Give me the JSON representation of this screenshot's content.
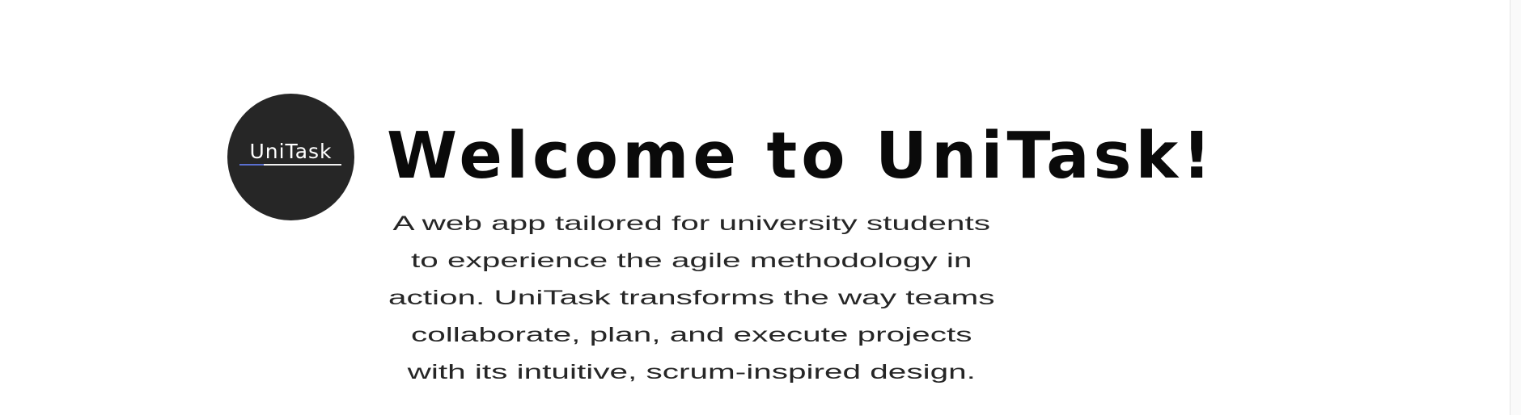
{
  "hero": {
    "logo_text": "UniTask",
    "title": "Welcome to UniTask!",
    "description": "A web app tailored for university students to experience the agile methodology in action. UniTask transforms the way teams collaborate, plan, and execute projects with its intuitive, scrum-inspired design."
  },
  "colors": {
    "logo_background": "#262626",
    "logo_text": "#ffffff",
    "logo_accent": "#5a6fd0",
    "title": "#0a0a0a",
    "description": "#262626",
    "page_background": "#ffffff"
  }
}
